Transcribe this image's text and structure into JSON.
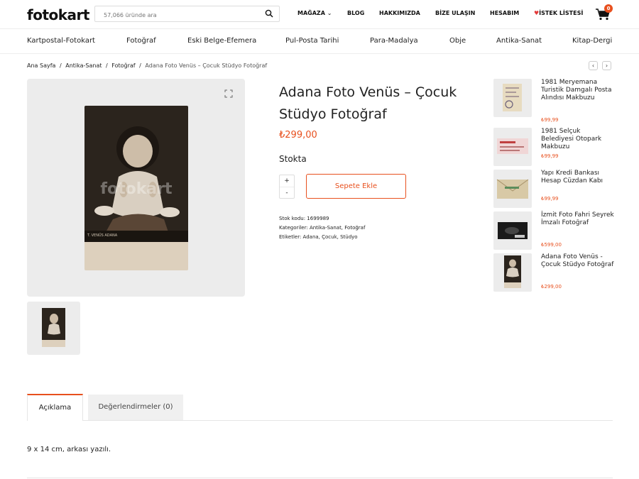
{
  "header": {
    "logo": "fotokart",
    "search_placeholder": "57,066 üründe ara",
    "nav": {
      "store": "MAĞAZA",
      "blog": "BLOG",
      "about": "HAKKIMIZDA",
      "contact": "BİZE ULAŞIN",
      "account": "HESABIM",
      "wishlist": "İSTEK LİSTESİ"
    },
    "cart_count": "0"
  },
  "categories": [
    "Kartpostal-Fotokart",
    "Fotoğraf",
    "Eski Belge-Efemera",
    "Pul-Posta Tarihi",
    "Para-Madalya",
    "Obje",
    "Antika-Sanat",
    "Kitap-Dergi"
  ],
  "breadcrumb": {
    "home": "Ana Sayfa",
    "sep": "/",
    "level1": "Antika-Sanat",
    "level2": "Fotoğraf",
    "current": "Adana Foto Venüs – Çocuk Stüdyo Fotoğraf"
  },
  "product": {
    "title": "Adana Foto Venüs – Çocuk Stüdyo Fotoğraf",
    "price": "₺299,00",
    "stock_status": "Stokta",
    "qty_plus": "+",
    "qty_minus": "-",
    "add_to_cart": "Sepete Ekle",
    "sku_line": "Stok kodu: 1699989",
    "categories_line": "Kategoriler: Antika-Sanat, Fotoğraf",
    "tags_line": "Etiketler: Adana, Çocuk, Stüdyo",
    "watermark": "fotokart",
    "photo_stamp": "T. VENÜS ADANA"
  },
  "related": [
    {
      "title": "1981 Meryemana Turistik Damgalı Posta Alındısı Makbuzu",
      "price": "₺99,99"
    },
    {
      "title": "1981 Selçuk Belediyesi Otopark Makbuzu",
      "price": "₺99,99"
    },
    {
      "title": "Yapı Kredi Bankası Hesap Cüzdan Kabı",
      "price": "₺99,99"
    },
    {
      "title": "İzmit Foto Fahri Seyrek İmzalı Fotoğraf",
      "price": "₺599,00"
    },
    {
      "title": "Adana Foto Venüs - Çocuk Stüdyo Fotoğraf",
      "price": "₺299,00"
    }
  ],
  "tabs": {
    "description": "Açıklama",
    "reviews": "Değerlendirmeler (0)"
  },
  "description_text": "9 x 14 cm, arkası yazılı.",
  "colors": {
    "accent": "#e8501e",
    "wishlist_heart": "#e43a3a",
    "gallery_bg": "#ececec"
  },
  "icons": [
    "search-icon",
    "chevron-down-icon",
    "heart-icon",
    "cart-icon",
    "expand-icon",
    "chevron-left-icon",
    "chevron-right-icon"
  ]
}
